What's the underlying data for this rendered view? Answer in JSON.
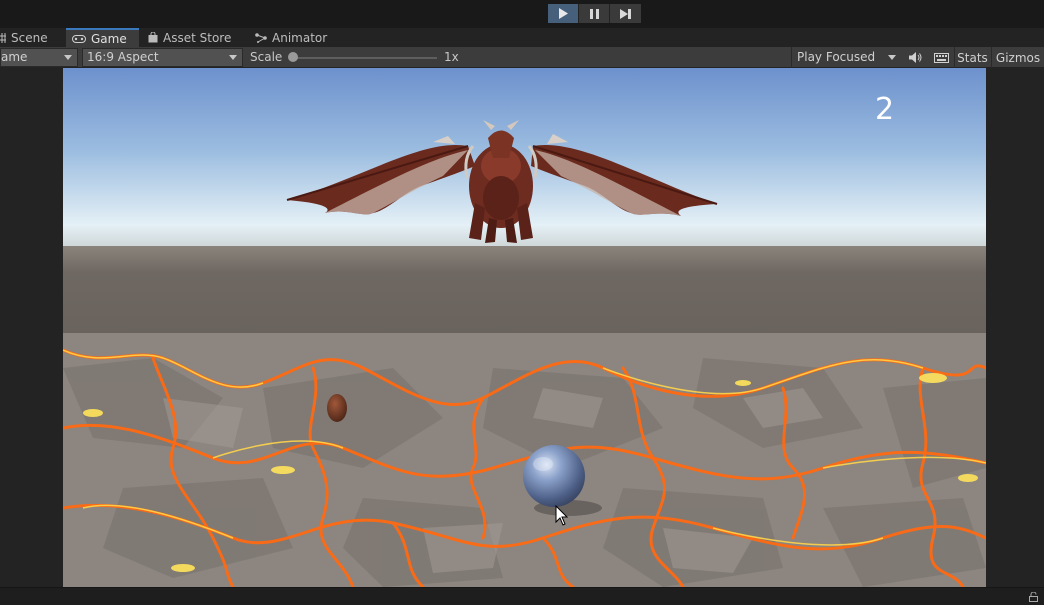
{
  "playbar": {
    "play_icon": "play-icon",
    "pause_icon": "pause-icon",
    "step_icon": "step-icon"
  },
  "tabs": [
    {
      "label": "Scene",
      "icon": "grid-icon"
    },
    {
      "label": "Game",
      "icon": "gamepad-icon"
    },
    {
      "label": "Asset Store",
      "icon": "bag-icon"
    },
    {
      "label": "Animator",
      "icon": "animator-icon"
    }
  ],
  "toolbar": {
    "display_value": "ame",
    "aspect_value": "16:9 Aspect",
    "scale_label": "Scale",
    "scale_value_text": "1x",
    "scale_value": 1,
    "play_mode_value": "Play Focused",
    "stats_label": "Stats",
    "gizmos_label": "Gizmos"
  },
  "game": {
    "score": "2"
  },
  "colors": {
    "accent": "#3a79bb",
    "play_active": "#46607c",
    "sky_top": "#6f94cf",
    "horizon": "#e6f1f6",
    "ground_far": "#6c6660",
    "lava": "#ff7a1a"
  }
}
